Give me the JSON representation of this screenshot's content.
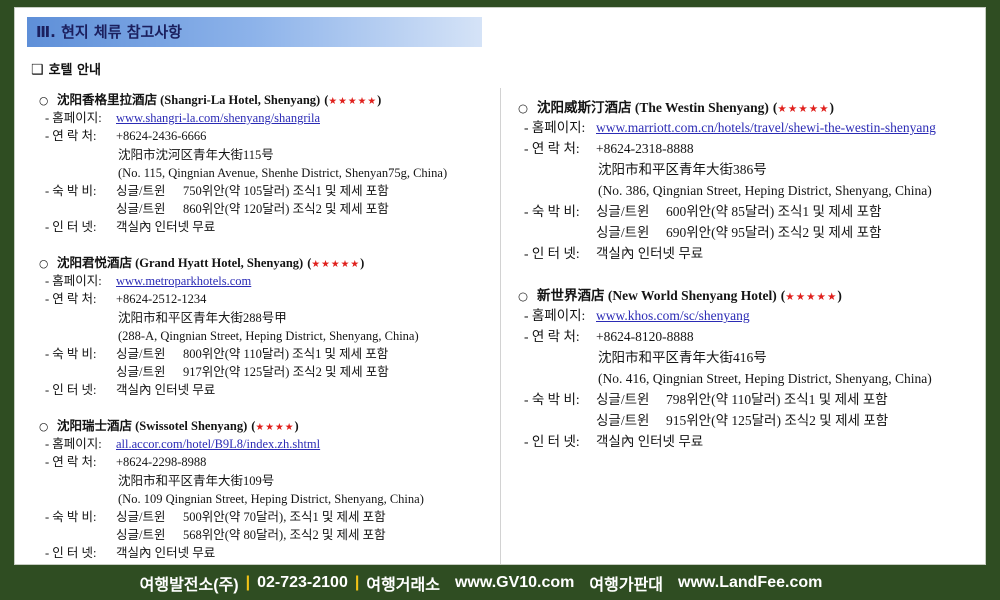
{
  "header": {
    "title": "Ⅲ. 현지 체류 참고사항"
  },
  "section": {
    "marker": "❑",
    "title": "호텔 안내"
  },
  "labels": {
    "homepage": "- 홈페이지:",
    "contact": "- 연 락 처:",
    "rate": "- 숙 박 비:",
    "internet": "- 인 터 넷:"
  },
  "punct": {
    "open": "(",
    "close": ")"
  },
  "hotels": [
    {
      "bullet": "○",
      "name": "沈阳香格里拉酒店 (Shangri-La Hotel, Shenyang)",
      "stars": "★★★★★",
      "homepage": "www.shangri-la.com/shenyang/shangrila",
      "phone": "+8624-2436-6666",
      "address_cn": "沈阳市沈河区青年大街115号",
      "address_en": "(No. 115, Qingnian Avenue, Shenhe District, Shenyan75g, China)",
      "rates": [
        {
          "type": "싱글/트윈",
          "detail": "750위안(약 105달러) 조식1 및 제세 포함"
        },
        {
          "type": "싱글/트윈",
          "detail": "860위안(약 120달러) 조식2 및 제세 포함"
        }
      ],
      "internet": "객실內 인터넷 무료"
    },
    {
      "bullet": "○",
      "name": "沈阳君悦酒店 (Grand Hyatt Hotel, Shenyang)",
      "stars": "★★★★★",
      "homepage": "www.metroparkhotels.com",
      "phone": "+8624-2512-1234",
      "address_cn": "沈阳市和平区青年大街288号甲",
      "address_en": "(288-A, Qingnian Street, Heping District, Shenyang, China)",
      "rates": [
        {
          "type": "싱글/트윈",
          "detail": "800위안(약 110달러) 조식1 및 제세 포함"
        },
        {
          "type": "싱글/트윈",
          "detail": "917위안(약 125달러) 조식2 및 제세 포함"
        }
      ],
      "internet": "객실內 인터넷 무료"
    },
    {
      "bullet": "○",
      "name": "沈阳瑞士酒店 (Swissotel Shenyang)",
      "stars": "★★★★",
      "homepage": "all.accor.com/hotel/B9L8/index.zh.shtml",
      "phone": "+8624-2298-8988",
      "address_cn": "沈阳市和平区青年大街109号",
      "address_en": "(No. 109 Qingnian Street, Heping District, Shenyang, China)",
      "rates": [
        {
          "type": "싱글/트윈",
          "detail": "500위안(약 70달러), 조식1 및 제세 포함"
        },
        {
          "type": "싱글/트윈",
          "detail": "568위안(약 80달러), 조식2 및 제세 포함"
        }
      ],
      "internet": "객실內 인터넷 무료"
    },
    {
      "bullet": "○",
      "name": "沈阳威斯汀酒店 (The Westin Shenyang)",
      "stars": "★★★★★",
      "homepage": "www.marriott.com.cn/hotels/travel/shewi-the-westin-shenyang",
      "phone": "+8624-2318-8888",
      "address_cn": "沈阳市和平区青年大街386号",
      "address_en": "(No. 386, Qingnian Street, Heping District, Shenyang, China)",
      "rates": [
        {
          "type": "싱글/트윈",
          "detail": "600위안(약 85달러) 조식1 및 제세 포함"
        },
        {
          "type": "싱글/트윈",
          "detail": "690위안(약 95달러) 조식2 및 제세 포함"
        }
      ],
      "internet": "객실內 인터넷 무료"
    },
    {
      "bullet": "○",
      "name": "新世界酒店 (New World Shenyang Hotel)",
      "stars": "★★★★★",
      "homepage": "www.khos.com/sc/shenyang",
      "phone": "+8624-8120-8888",
      "address_cn": "沈阳市和平区青年大街416号",
      "address_en": "(No. 416, Qingnian Street, Heping District, Shenyang, China)",
      "rates": [
        {
          "type": "싱글/트윈",
          "detail": "798위안(약 110달러) 조식1 및 제세 포함"
        },
        {
          "type": "싱글/트윈",
          "detail": "915위안(약 125달러) 조식2 및 제세 포함"
        }
      ],
      "internet": "객실內 인터넷 무료"
    }
  ],
  "footer": {
    "company": "여행발전소(주)",
    "separator": "|",
    "phone": "02-723-2100",
    "sites": [
      {
        "name": "여행거래소",
        "url": "www.GV10.com"
      },
      {
        "name": "여행가판대",
        "url": "www.LandFee.com"
      }
    ]
  },
  "colors": {
    "frame": "#2f4d22",
    "star": "#e0201c",
    "link": "#2b2bb5",
    "sep": "#f3c316",
    "header_text": "#1b1f5e"
  }
}
